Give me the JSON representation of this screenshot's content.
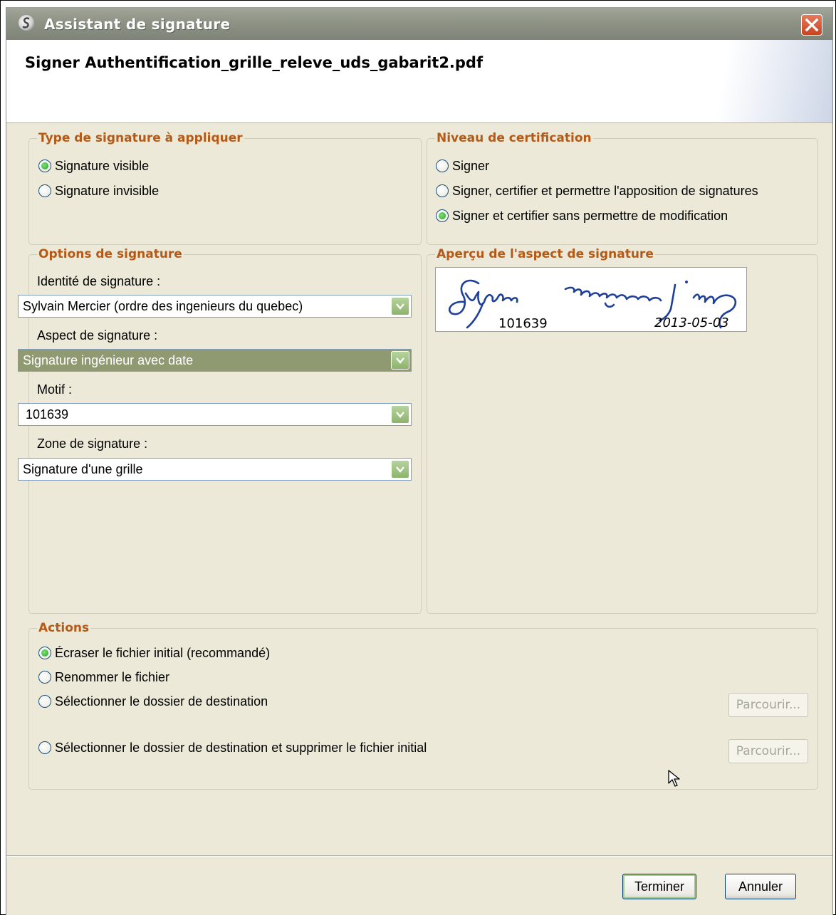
{
  "window": {
    "title": "Assistant de signature",
    "heading": "Signer Authentification_grille_releve_uds_gabarit2.pdf"
  },
  "signature_type": {
    "legend": "Type de signature à appliquer",
    "options": [
      {
        "label": "Signature visible",
        "checked": true
      },
      {
        "label": "Signature invisible",
        "checked": false
      }
    ]
  },
  "certification": {
    "legend": "Niveau de certification",
    "options": [
      {
        "label": "Signer",
        "checked": false
      },
      {
        "label": "Signer, certifier et permettre l'apposition de signatures",
        "checked": false
      },
      {
        "label": "Signer et certifier sans permettre de modification",
        "checked": true
      }
    ]
  },
  "options": {
    "legend": "Options de signature",
    "identity_label": "Identité de signature :",
    "identity_value": "Sylvain Mercier (ordre des ingenieurs du quebec)",
    "aspect_label": "Aspect de signature :",
    "aspect_value": "Signature ingénieur avec date",
    "motif_label": "Motif :",
    "motif_value": "101639",
    "zone_label": "Zone de signature :",
    "zone_value": "Signature d'une grille"
  },
  "preview": {
    "legend": "Aperçu de l'aspect de signature",
    "number": "101639",
    "date": "2013-05-03"
  },
  "actions": {
    "legend": "Actions",
    "options": [
      {
        "label": "Écraser le fichier initial (recommandé)",
        "checked": true
      },
      {
        "label": "Renommer le fichier",
        "checked": false
      },
      {
        "label": "Sélectionner le dossier de destination",
        "checked": false
      },
      {
        "label": "Sélectionner le dossier de destination et supprimer le fichier initial",
        "checked": false
      }
    ],
    "browse_label": "Parcourir..."
  },
  "footer": {
    "finish_label": "Terminer",
    "cancel_label": "Annuler"
  }
}
